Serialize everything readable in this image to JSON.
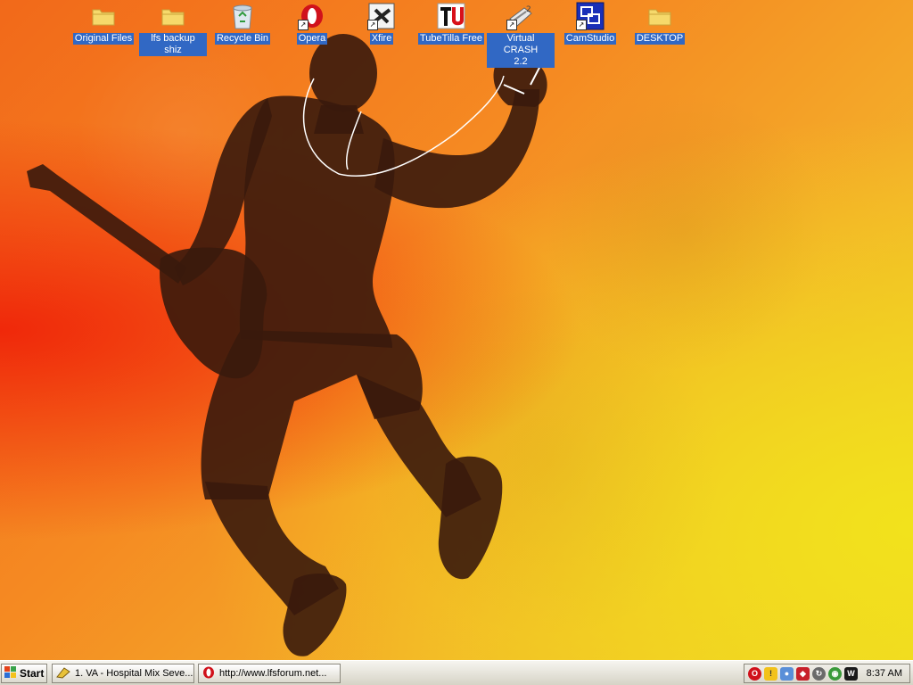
{
  "desktop_icons": [
    {
      "name": "original-files-icon",
      "label": "Original Files",
      "type": "folder",
      "shortcut": false
    },
    {
      "name": "lfs-backup-icon",
      "label": "lfs backup shiz",
      "type": "folder",
      "shortcut": false
    },
    {
      "name": "recycle-bin-icon",
      "label": "Recycle Bin",
      "type": "recycle-bin",
      "shortcut": false
    },
    {
      "name": "opera-icon",
      "label": "Opera",
      "type": "opera",
      "shortcut": true
    },
    {
      "name": "xfire-icon",
      "label": "Xfire",
      "type": "xfire",
      "shortcut": true
    },
    {
      "name": "tubetilla-icon",
      "label": "TubeTilla Free",
      "type": "tubetilla",
      "shortcut": false
    },
    {
      "name": "virtual-crash-icon",
      "label": "Virtual CRASH\n2.2",
      "type": "virtual-crash",
      "shortcut": true
    },
    {
      "name": "camstudio-icon",
      "label": "CamStudio",
      "type": "camstudio",
      "shortcut": true
    },
    {
      "name": "desktop-folder-icon",
      "label": "DESKTOP",
      "type": "folder",
      "shortcut": false
    }
  ],
  "taskbar": {
    "start_label": "Start",
    "tasks": [
      {
        "label": "1. VA - Hospital Mix Seve...",
        "icon": "media-player-icon"
      },
      {
        "label": "http://www.lfsforum.net...",
        "icon": "opera-icon"
      }
    ],
    "tray_icons": [
      "opera-tray-icon",
      "security-shield-icon",
      "network-users-icon",
      "antivirus-shield-icon",
      "sync-icon",
      "chrome-ball-icon",
      "winamp-icon"
    ],
    "clock": "8:37 AM"
  },
  "colors": {
    "icon_label_bg": "#3168c4",
    "taskbar_bg": "#e4e1d6",
    "wallpaper_red": "#f0280a",
    "wallpaper_orange": "#f58a22",
    "wallpaper_yellow": "#eed226"
  }
}
